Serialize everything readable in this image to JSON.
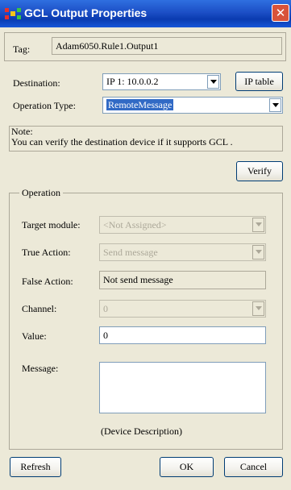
{
  "window": {
    "title": "GCL Output Properties",
    "close_glyph": "✕"
  },
  "tag": {
    "label": "Tag:",
    "value": "Adam6050.Rule1.Output1"
  },
  "destination": {
    "label": "Destination:",
    "value": "IP 1: 10.0.0.2",
    "ip_table_button": "IP table"
  },
  "operation_type": {
    "label": "Operation Type:",
    "value": "RemoteMessage"
  },
  "note": {
    "line1": "Note:",
    "line2": "You can verify the destination device if it supports GCL ."
  },
  "verify_button": "Verify",
  "operation": {
    "legend": "Operation",
    "target_module": {
      "label": "Target module:",
      "value": "<Not Assigned>"
    },
    "true_action": {
      "label": "True Action:",
      "value": "Send message"
    },
    "false_action": {
      "label": "False Action:",
      "value": "Not send message"
    },
    "channel": {
      "label": "Channel:",
      "value": "0"
    },
    "value": {
      "label": "Value:",
      "value": "0"
    },
    "message": {
      "label": "Message:",
      "value": ""
    },
    "device_description": "(Device Description)"
  },
  "buttons": {
    "refresh": "Refresh",
    "ok": "OK",
    "cancel": "Cancel"
  },
  "colors": {
    "titlebar": "#1c4fc6",
    "selection": "#316ac5",
    "dialog_bg": "#ece9d8"
  },
  "icons": {
    "app": "gcl-logo-icon",
    "close": "close-icon",
    "dropdown": "chevron-down-icon"
  }
}
